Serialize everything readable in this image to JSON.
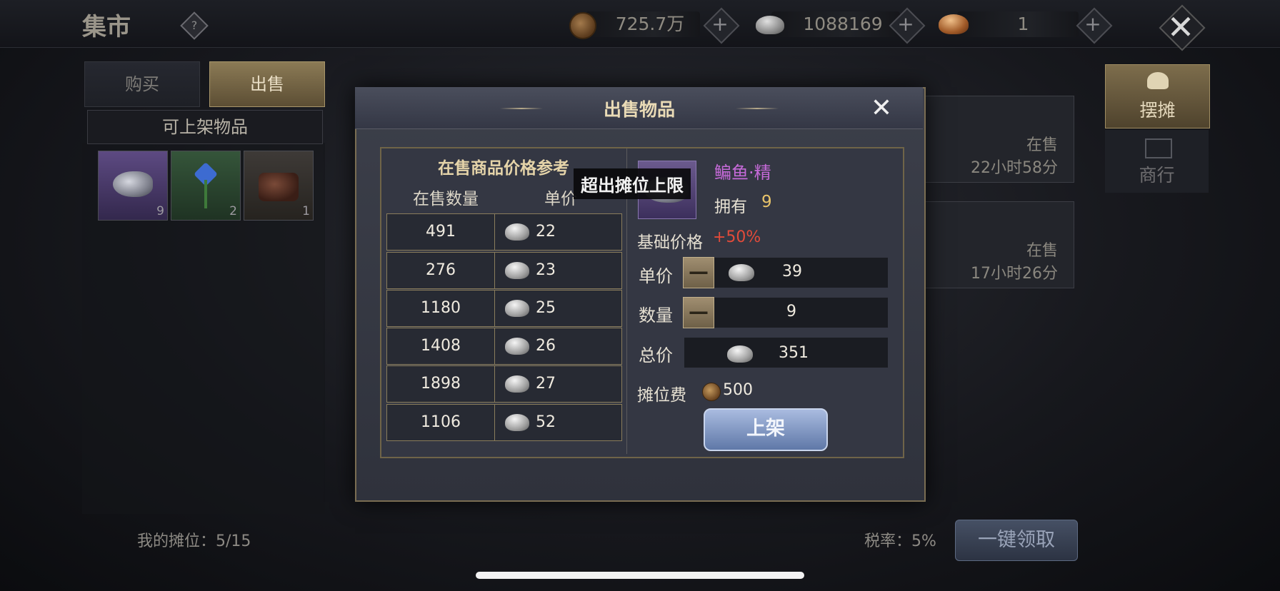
{
  "header": {
    "title": "集市",
    "help_label": "?",
    "currency_copper": "725.7万",
    "currency_silver": "1088169",
    "currency_gold": "1",
    "plus_label": "+",
    "close_label": "✕"
  },
  "left_panel": {
    "tabs": [
      {
        "label": "购买"
      },
      {
        "label": "出售"
      }
    ],
    "available_title": "可上架物品",
    "items": [
      {
        "count": "9",
        "color": "#4b3a6e"
      },
      {
        "count": "2",
        "color": "#2c4a30"
      },
      {
        "count": "1",
        "color": "#3a3633"
      }
    ]
  },
  "right_panel": {
    "tabs": [
      {
        "label": "摆摊"
      },
      {
        "label": "商行"
      }
    ],
    "listings": [
      {
        "status": "在售",
        "time": "22小时58分"
      },
      {
        "status": "在售",
        "time": "17小时26分"
      }
    ]
  },
  "footer": {
    "my_stall": "我的摊位：5/15",
    "tax_rate": "税率：5%",
    "claim_all": "一键领取"
  },
  "dialog": {
    "title": "出售物品",
    "close": "✕",
    "ref_title": "在售商品价格参考",
    "col_qty": "在售数量",
    "col_price": "单价",
    "ref_rows": [
      {
        "qty": "491",
        "price": "22"
      },
      {
        "qty": "276",
        "price": "23"
      },
      {
        "qty": "1180",
        "price": "25"
      },
      {
        "qty": "1408",
        "price": "26"
      },
      {
        "qty": "1898",
        "price": "27"
      },
      {
        "qty": "1106",
        "price": "52"
      }
    ],
    "item_name": "鳊鱼·精",
    "own_label": "拥有",
    "own_value": "9",
    "base_price_label": "基础价格",
    "base_price_bonus": "+50%",
    "unit_price_label": "单价",
    "unit_price_value": "39",
    "quantity_label": "数量",
    "quantity_value": "9",
    "total_label": "总价",
    "total_value": "351",
    "fee_label": "摊位费",
    "fee_value": "500",
    "minus_label": "—",
    "list_button": "上架",
    "toast": "超出摊位上限"
  }
}
